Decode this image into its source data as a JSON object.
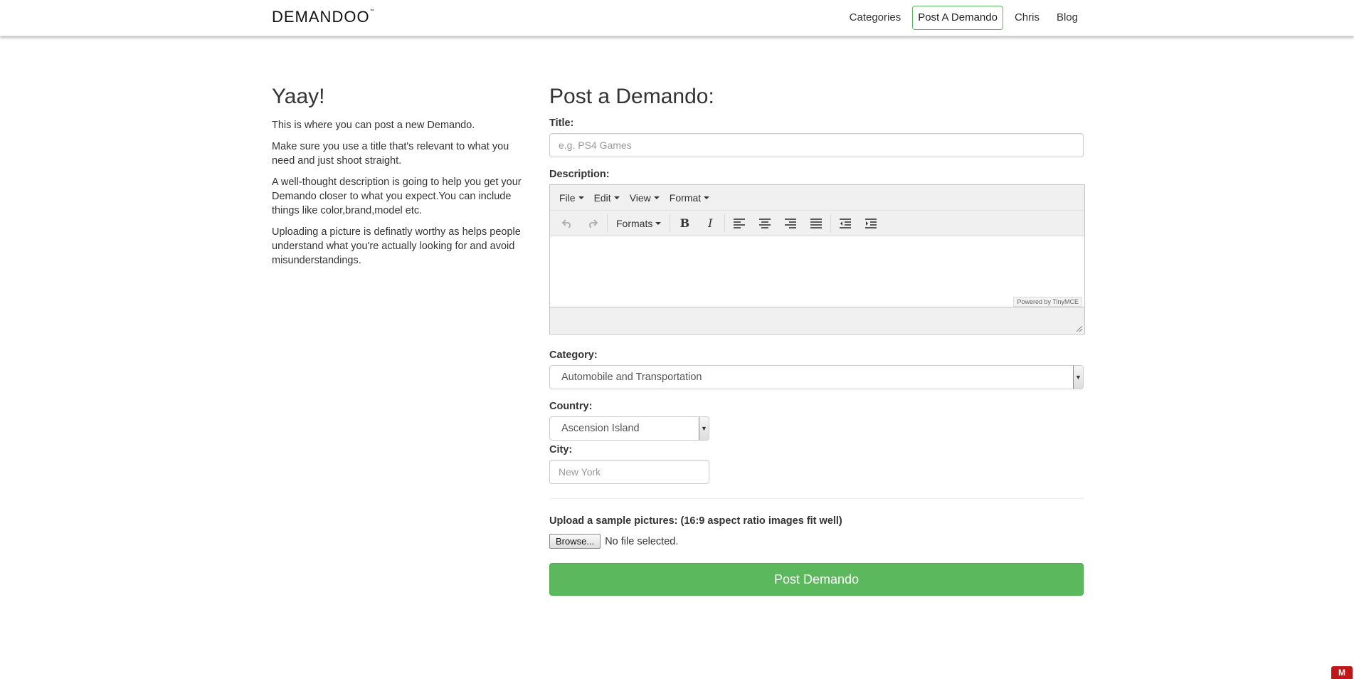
{
  "brand": {
    "name": "DEMANDOO",
    "tm": "™"
  },
  "nav": {
    "items": [
      {
        "label": "Categories"
      },
      {
        "label": "Post A Demando"
      },
      {
        "label": "Chris"
      },
      {
        "label": "Blog"
      }
    ]
  },
  "intro": {
    "heading": "Yaay!",
    "paragraphs": [
      "This is where you can post a new Demando.",
      "Make sure you use a title that's relevant to what you need and just shoot straight.",
      "A well-thought description is going to help you get your Demando closer to what you expect.You can include things like color,brand,model etc.",
      "Uploading a picture is definatly worthy as helps people understand what you're actually looking for and avoid misunderstandings."
    ]
  },
  "form": {
    "heading": "Post a Demando:",
    "title_label": "Title:",
    "title_placeholder": "e.g. PS4 Games",
    "description_label": "Description:",
    "editor": {
      "menus": [
        "File",
        "Edit",
        "View",
        "Format"
      ],
      "formats_label": "Formats",
      "powered_by": "Powered by TinyMCE",
      "content": ""
    },
    "category_label": "Category:",
    "category_value": "Automobile and Transportation",
    "country_label": "Country:",
    "country_value": "Ascension Island",
    "city_label": "City:",
    "city_placeholder": "New York",
    "upload_label": "Upload a sample pictures: (16:9 aspect ratio images fit well)",
    "browse_label": "Browse...",
    "file_status": "No file selected.",
    "submit_label": "Post Demando"
  },
  "colors": {
    "accent": "#5cb85c"
  }
}
